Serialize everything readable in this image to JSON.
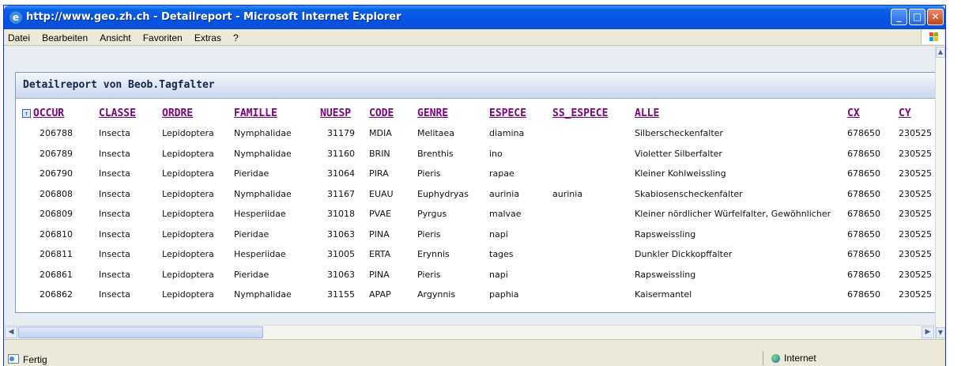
{
  "window": {
    "title": "http://www.geo.zh.ch - Detailreport - Microsoft Internet Explorer",
    "minimize_glyph": "_",
    "maximize_glyph": "□",
    "close_glyph": "✕"
  },
  "menu": [
    "Datei",
    "Bearbeiten",
    "Ansicht",
    "Favoriten",
    "Extras",
    "?"
  ],
  "report": {
    "title": "Detailreport von Beob.Tagfalter",
    "columns": [
      "OCCUR",
      "CLASSE",
      "ORDRE",
      "FAMILLE",
      "NUESP",
      "CODE",
      "GENRE",
      "ESPECE",
      "SS_ESPECE",
      "ALLE",
      "CX",
      "CY"
    ],
    "rows": [
      [
        "206788",
        "Insecta",
        "Lepidoptera",
        "Nymphalidae",
        "31179",
        "MDIA",
        "Melitaea",
        "diamina",
        "",
        "Silberscheckenfalter",
        "678650",
        "230525"
      ],
      [
        "206789",
        "Insecta",
        "Lepidoptera",
        "Nymphalidae",
        "31160",
        "BRIN",
        "Brenthis",
        "ino",
        "",
        "Violetter Silberfalter",
        "678650",
        "230525"
      ],
      [
        "206790",
        "Insecta",
        "Lepidoptera",
        "Pieridae",
        "31064",
        "PIRA",
        "Pieris",
        "rapae",
        "",
        "Kleiner Kohlweissling",
        "678650",
        "230525"
      ],
      [
        "206808",
        "Insecta",
        "Lepidoptera",
        "Nymphalidae",
        "31167",
        "EUAU",
        "Euphydryas",
        "aurinia",
        "aurinia",
        "Skabiosenscheckenfalter",
        "678650",
        "230525"
      ],
      [
        "206809",
        "Insecta",
        "Lepidoptera",
        "Hesperiidae",
        "31018",
        "PVAE",
        "Pyrgus",
        "malvae",
        "",
        "Kleiner nördlicher Würfelfalter, Gewöhnlicher",
        "678650",
        "230525"
      ],
      [
        "206810",
        "Insecta",
        "Lepidoptera",
        "Pieridae",
        "31063",
        "PINA",
        "Pieris",
        "napi",
        "",
        "Rapsweissling",
        "678650",
        "230525"
      ],
      [
        "206811",
        "Insecta",
        "Lepidoptera",
        "Hesperiidae",
        "31005",
        "ERTA",
        "Erynnis",
        "tages",
        "",
        "Dunkler Dickkopffalter",
        "678650",
        "230525"
      ],
      [
        "206861",
        "Insecta",
        "Lepidoptera",
        "Pieridae",
        "31063",
        "PINA",
        "Pieris",
        "napi",
        "",
        "Rapsweissling",
        "678650",
        "230525"
      ],
      [
        "206862",
        "Insecta",
        "Lepidoptera",
        "Nymphalidae",
        "31155",
        "APAP",
        "Argynnis",
        "paphia",
        "",
        "Kaisermantel",
        "678650",
        "230525"
      ]
    ]
  },
  "status": {
    "text": "Fertig",
    "zone": "Internet"
  },
  "colors": {
    "titlebar": "#0454e3",
    "header_link": "#800080",
    "panel_border": "#7c97c8"
  }
}
